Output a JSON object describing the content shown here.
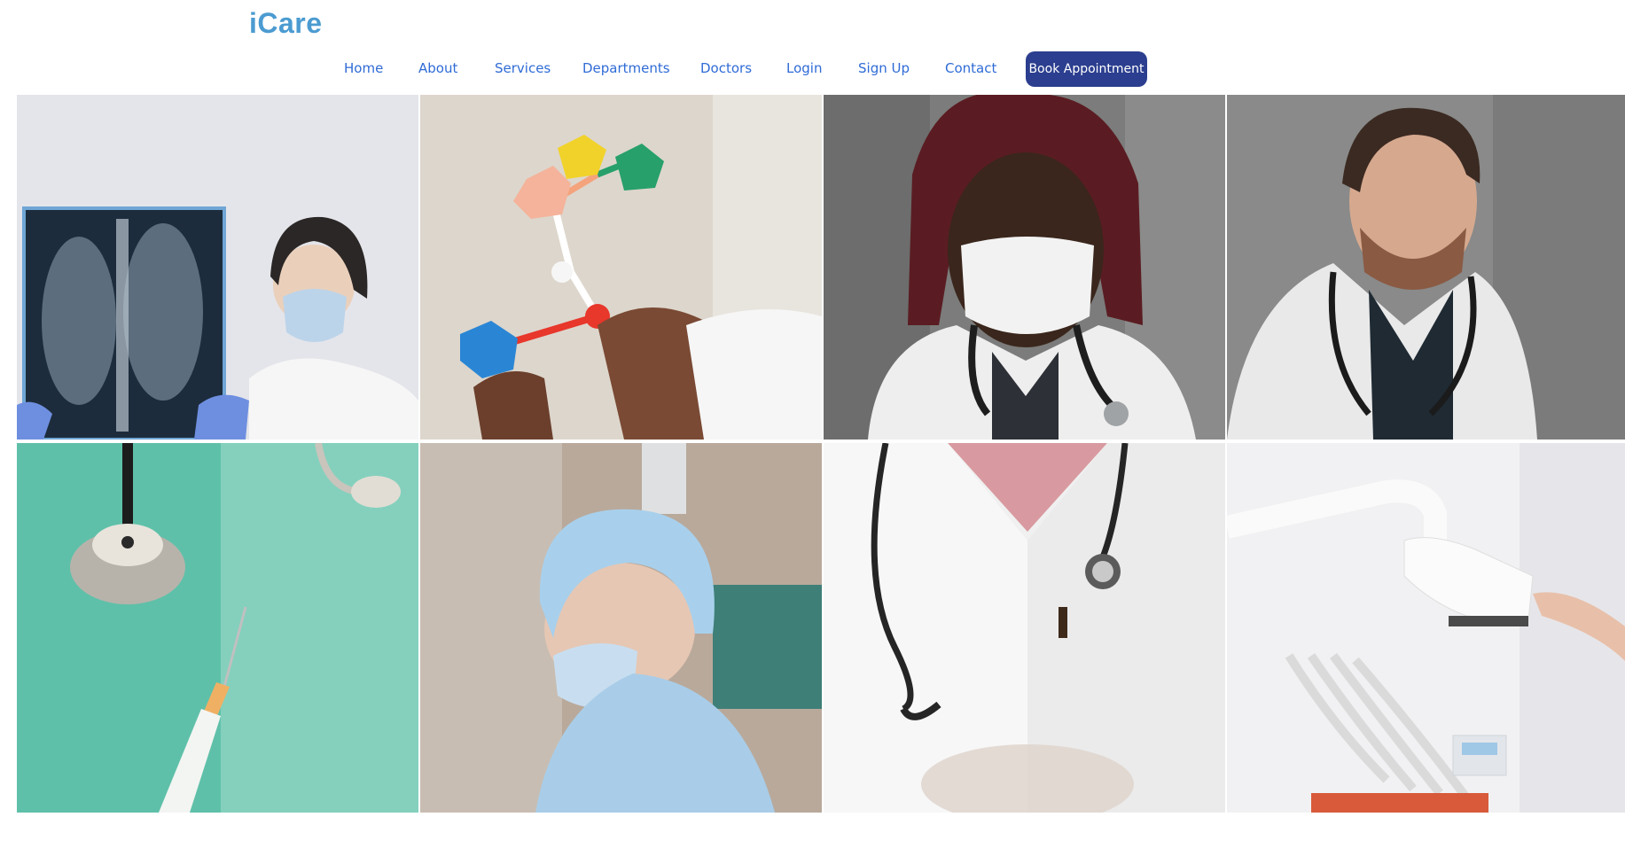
{
  "brand": {
    "logo_text": "iCare"
  },
  "nav": {
    "items": [
      {
        "label": "Home"
      },
      {
        "label": "About"
      },
      {
        "label": "Services"
      },
      {
        "label": "Departments"
      },
      {
        "label": "Doctors"
      },
      {
        "label": "Login"
      },
      {
        "label": "Sign Up"
      },
      {
        "label": "Contact"
      }
    ],
    "cta_label": "Book Appointment"
  },
  "colors": {
    "logo": "#4b9bd1",
    "nav_link": "#2f6bd6",
    "cta_background": "#2b3e8f",
    "cta_text": "#ffffff"
  },
  "gallery": {
    "images": [
      {
        "subject": "doctor-holding-xray"
      },
      {
        "subject": "molecule-model"
      },
      {
        "subject": "doctor-with-face-mask"
      },
      {
        "subject": "doctor-with-stethoscope"
      },
      {
        "subject": "stethoscope-and-syringe"
      },
      {
        "subject": "surgeon-in-scrub-cap"
      },
      {
        "subject": "doctor-white-coat"
      },
      {
        "subject": "dental-chair-lamp"
      }
    ]
  }
}
